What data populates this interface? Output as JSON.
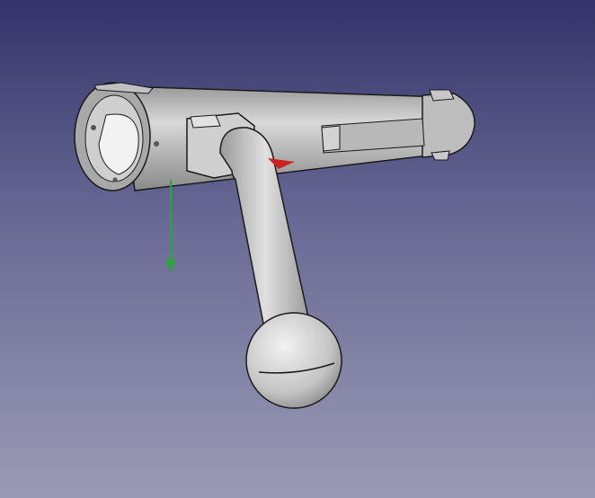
{
  "viewport": {
    "background_top": "#33336a",
    "background_bottom": "#9a9ab4"
  },
  "model": {
    "body_color": "#c8c8c8",
    "edge_color": "#1a1a1a"
  },
  "axes": {
    "x_axis_color": "#cc2222",
    "y_axis_color": "#22aa33"
  }
}
